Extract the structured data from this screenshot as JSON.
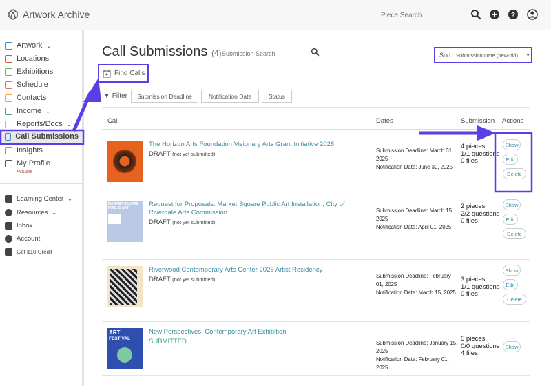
{
  "app": {
    "name": "Artwork Archive",
    "piece_search_placeholder": "Piece Search"
  },
  "header_icons": [
    "search-icon",
    "plus-circle-icon",
    "help-icon",
    "user-icon"
  ],
  "sidebar": {
    "items": [
      {
        "label": "Artwork",
        "icon": "image-icon",
        "chevron": true,
        "color": "#3a8dc9"
      },
      {
        "label": "Locations",
        "icon": "location-arrow-icon",
        "color": "#d9534f"
      },
      {
        "label": "Exhibitions",
        "icon": "map-pin-icon",
        "color": "#5cb85c"
      },
      {
        "label": "Schedule",
        "icon": "calendar-icon",
        "color": "#e86a6a"
      },
      {
        "label": "Contacts",
        "icon": "person-icon",
        "color": "#e8a93a"
      },
      {
        "label": "Income",
        "icon": "money-icon",
        "chevron": true,
        "color": "#4aa56b"
      },
      {
        "label": "Reports/Docs",
        "icon": "document-icon",
        "chevron": true,
        "color": "#e8b93a"
      },
      {
        "label": "Call Submissions",
        "icon": "calendar-plus-icon",
        "active": true,
        "color": "#3a8dc9"
      },
      {
        "label": "Insights",
        "icon": "chart-icon",
        "color": "#5cb85c"
      },
      {
        "label": "My Profile",
        "icon": "globe-icon",
        "sublabel": "Private",
        "color": "#555555"
      }
    ],
    "secondary": [
      {
        "label": "Learning Center",
        "icon": "graduation-cap-icon",
        "chevron": true
      },
      {
        "label": "Resources",
        "icon": "info-icon",
        "chevron": true
      },
      {
        "label": "Inbox",
        "icon": "envelope-icon"
      },
      {
        "label": "Account",
        "icon": "user-circle-icon"
      },
      {
        "label": "Get $10 Credit",
        "icon": "gift-icon"
      }
    ]
  },
  "main": {
    "title": "Call Submissions",
    "count": "(4)",
    "search_placeholder": "Submission Search",
    "sort": {
      "label": "Sort:",
      "value": "Submission Date (new-old)"
    },
    "find_calls": "Find Calls",
    "filter": {
      "label": "Filter",
      "buttons": [
        "Submission Deadline",
        "Notification Date",
        "Status"
      ]
    },
    "columns": [
      "Call",
      "Dates",
      "Submission",
      "Actions"
    ],
    "rows": [
      {
        "title": "The Horizon Arts Foundation Visionary Arts Grant Initiative 2025",
        "status": "DRAFT",
        "status_note": "(not yet submitted)",
        "deadline": "Submission Deadline: March 31, 2025",
        "notification": "Notification Date: June 30, 2025",
        "pieces": "4 pieces",
        "questions": "1/1 questions",
        "files": "0 files",
        "actions": [
          "Show",
          "Edit",
          "Delete"
        ]
      },
      {
        "title": "Request for Proposals: Market Square Public Art Installation, City of Riverdale Arts Commission",
        "status": "DRAFT",
        "status_note": "(not yet submitted)",
        "deadline": "Submission Deadline: March 15, 2025",
        "notification": "Notification Date: April 01, 2025",
        "pieces": "2 pieces",
        "questions": "2/2 questions",
        "files": "0 files",
        "actions": [
          "Show",
          "Edit",
          "Delete"
        ],
        "thumb_text": "MARKET SQUARE PUBLIC ART"
      },
      {
        "title": "Riverwood Contemporary Arts Center 2025 Artist Residency",
        "status": "DRAFT",
        "status_note": "(not yet submitted)",
        "deadline": "Submission Deadline: February 01, 2025",
        "notification": "Notification Date: March 15, 2025",
        "pieces": "3 pieces",
        "questions": "1/1 questions",
        "files": "0 files",
        "actions": [
          "Show",
          "Edit",
          "Delete"
        ]
      },
      {
        "title": "New Perspectives: Contemporary Art Exhibition",
        "status": "SUBMITTED",
        "status_note": "",
        "deadline": "Submission Deadline: January 15, 2025",
        "notification": "Notification Date: February 01, 2025",
        "pieces": "5 pieces",
        "questions": "0/0 questions",
        "files": "4 files",
        "actions": [
          "Show"
        ],
        "thumb_text": "ART FESTIVAL"
      }
    ]
  },
  "colors": {
    "accent": "#3a8da3",
    "annotation": "#5a3ee6",
    "submitted": "#3aa87a",
    "private": "#c0504d"
  }
}
